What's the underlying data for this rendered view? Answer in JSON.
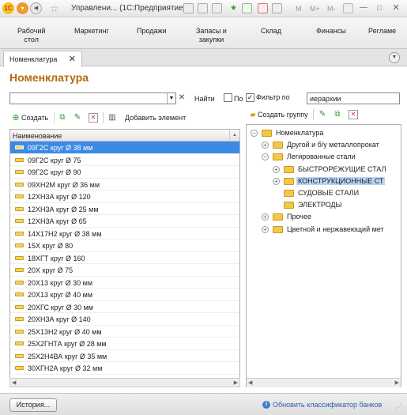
{
  "titlebar": {
    "logo": "1С",
    "title": "Управлени... (1С:Предприятие)",
    "tool_letters": [
      "M",
      "M+",
      "M-"
    ]
  },
  "sections": [
    {
      "line1": "Рабочий",
      "line2": "стол"
    },
    {
      "line1": "Маркетинг",
      "line2": ""
    },
    {
      "line1": "Продажи",
      "line2": ""
    },
    {
      "line1": "Запасы и",
      "line2": "закупки"
    },
    {
      "line1": "Склад",
      "line2": ""
    },
    {
      "line1": "Финансы",
      "line2": ""
    },
    {
      "line1": "Регламе",
      "line2": ""
    }
  ],
  "tab": {
    "label": "Номенклатура",
    "close": "✕"
  },
  "page_title": "Номенклатура",
  "search": {
    "value": "",
    "find_label": "Найти",
    "cb1_label": "По",
    "filter_label": "Фильтр по",
    "filter_value": "иерархии"
  },
  "toolbar_left": {
    "create": "Создать",
    "add_element": "Добавить элемент"
  },
  "toolbar_right": {
    "create_group": "Создать группу"
  },
  "list": {
    "header": "Наименование",
    "rows": [
      "09Г2С круг Ø 38 мм",
      "09Г2С круг Ø 75",
      "09Г2С круг Ø 90",
      "09ХН2М круг Ø 36 мм",
      "12ХН3А круг Ø 120",
      "12ХН3А круг Ø 25 мм",
      "12ХН3А круг Ø 65",
      "14Х17Н2 круг Ø 38 мм",
      "15Х круг Ø 80",
      "18ХГТ круг Ø 160",
      "20Х круг Ø 75",
      "20Х13 круг Ø 30 мм",
      "20Х13 круг Ø 40 мм",
      "20ХГС круг Ø 30 мм",
      "20ХН3А круг Ø 140",
      "25Х13Н2 круг Ø 40 мм",
      "25Х2ГНТА круг Ø 28 мм",
      "25Х2Н4ВА круг Ø 35 мм",
      "30ХГН2А круг Ø 32 мм"
    ]
  },
  "tree": {
    "items": [
      {
        "label": "Номенклатура",
        "exp": "⊖"
      },
      {
        "label": "Другой и б/у металлопрокат",
        "exp": "⊕"
      },
      {
        "label": "Легированные стали",
        "exp": "⊖"
      },
      {
        "label": "БЫСТРОРЕЖУЩИЕ СТАЛ",
        "exp": "⊕"
      },
      {
        "label": "КОНСТРУКЦИОННЫЕ СТ",
        "exp": "⊕"
      },
      {
        "label": "СУДОВЫЕ СТАЛИ",
        "exp": ""
      },
      {
        "label": "ЭЛЕКТРОДЫ",
        "exp": ""
      },
      {
        "label": "Прочее",
        "exp": "⊕"
      },
      {
        "label": "Цветной и нержавеющий мет",
        "exp": "⊕"
      }
    ]
  },
  "statusbar": {
    "history": "История...",
    "bank_link": "Обновить классификатор банков"
  }
}
